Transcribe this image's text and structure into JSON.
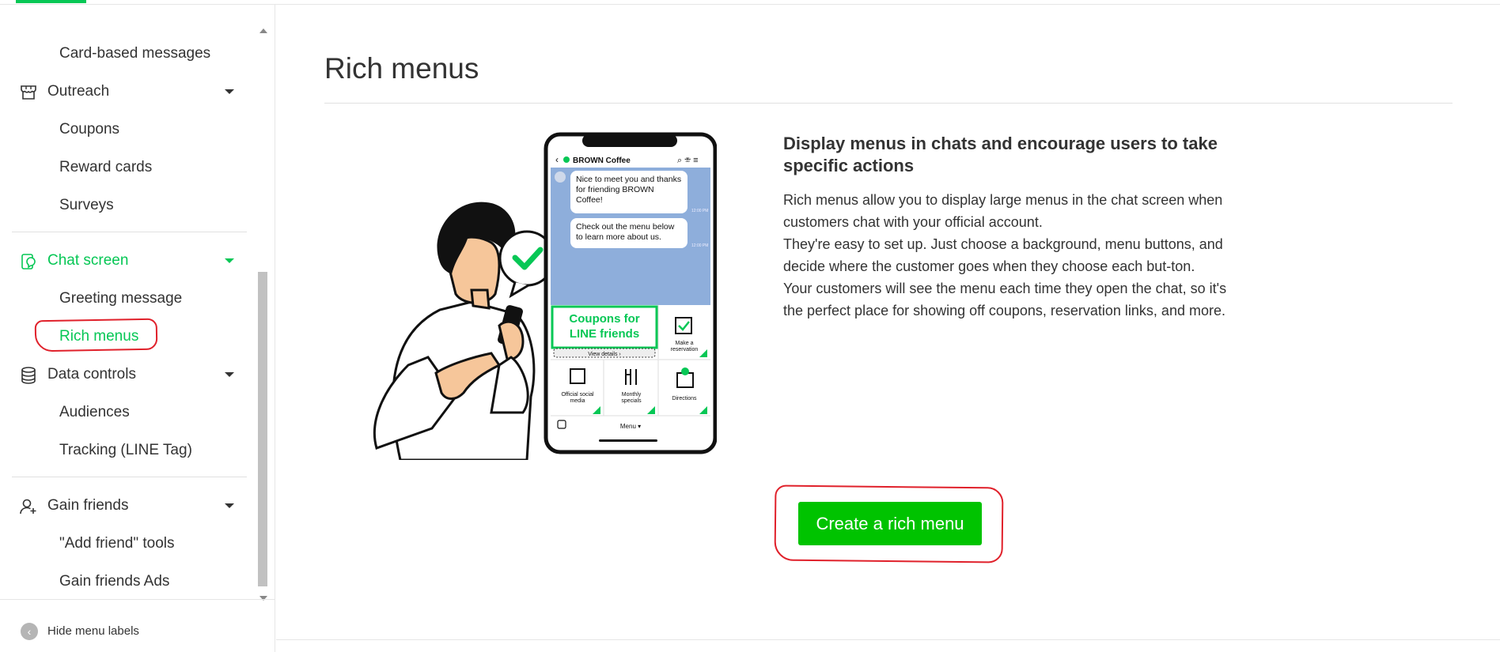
{
  "sidebar": {
    "items": [
      {
        "label": "Card-based messages"
      },
      {
        "label": "Outreach",
        "icon": "store-icon"
      },
      {
        "label": "Coupons"
      },
      {
        "label": "Reward cards"
      },
      {
        "label": "Surveys"
      },
      {
        "label": "Chat screen",
        "icon": "chat-screen-icon"
      },
      {
        "label": "Greeting message"
      },
      {
        "label": "Rich menus"
      },
      {
        "label": "Data controls",
        "icon": "database-icon"
      },
      {
        "label": "Audiences"
      },
      {
        "label": "Tracking (LINE Tag)"
      },
      {
        "label": "Gain friends",
        "icon": "add-user-icon"
      },
      {
        "label": "\"Add friend\" tools"
      },
      {
        "label": "Gain friends Ads"
      }
    ],
    "hide_labels": "Hide menu labels"
  },
  "main": {
    "title": "Rich menus",
    "heading": "Display menus in chats and encourage users to take specific actions",
    "body": [
      "Rich menus allow you to display large menus in the chat screen when customers chat with your official account.",
      "They're easy to set up. Just choose a background, menu buttons, and decide where the customer goes when they choose each but-ton.",
      "Your customers will see the menu each time they open the chat, so it's the perfect place for showing off coupons, reservation links, and more."
    ],
    "create_button": "Create a rich menu"
  },
  "phone": {
    "account": "BROWN Coffee",
    "msg1": "Nice to meet you and thanks for friending BROWN Coffee!",
    "msg2": "Check out the menu below to learn more about us.",
    "time1": "12:00 PM",
    "time2": "12:00 PM",
    "coupon_line1": "Coupons for",
    "coupon_line2": "LINE friends",
    "view_details": "View details ›",
    "make_res1": "Make a",
    "make_res2": "reservation",
    "social1": "Official social",
    "social2": "media",
    "monthly1": "Monthly",
    "monthly2": "specials",
    "directions": "Directions",
    "menu_label": "Menu ▾"
  },
  "colors": {
    "accent": "#06c755",
    "button": "#00c300",
    "annotation": "#e0212b",
    "chat_bg": "#8eaedb"
  }
}
